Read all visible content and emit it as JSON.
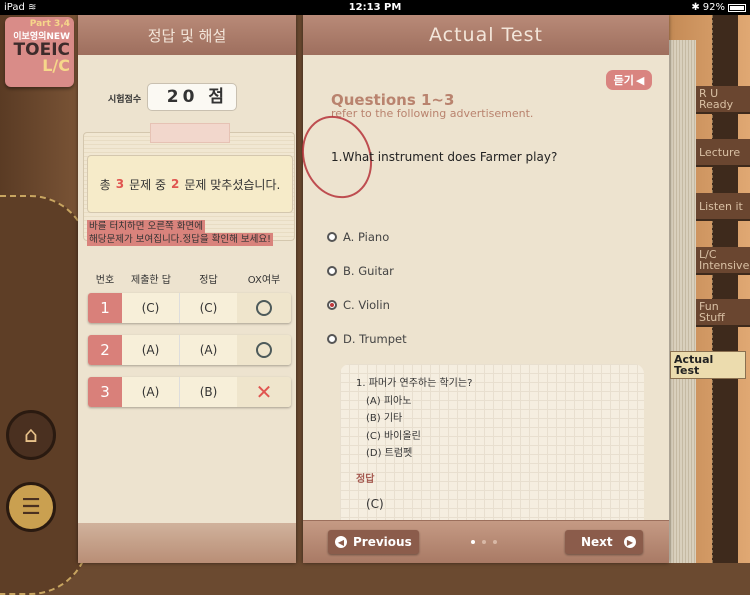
{
  "status": {
    "device": "iPad",
    "time": "12:13 PM",
    "battery": "92%",
    "battery_level": 0.92
  },
  "logo": {
    "part": "Part 3,4",
    "author": "이보영의NEW",
    "title": "TOEIC",
    "sub": "L/C"
  },
  "left": {
    "title": "정답 및 해설",
    "score_label": "시험점수",
    "score": "20 점",
    "summary": {
      "pre": "총",
      "total": "3",
      "mid": "문제 중",
      "correct": "2",
      "post": "문제 맞추셨습니다."
    },
    "hint": [
      "바를 터치하면 오른쪽 화면에",
      "해당문제가 보여집니다.정답을 확인해 보세요!"
    ],
    "columns": [
      "번호",
      "제출한 답",
      "정답",
      "OX여부"
    ],
    "rows": [
      {
        "no": "1",
        "submitted": "(C)",
        "answer": "(C)",
        "result": "O"
      },
      {
        "no": "2",
        "submitted": "(A)",
        "answer": "(A)",
        "result": "O"
      },
      {
        "no": "3",
        "submitted": "(A)",
        "answer": "(B)",
        "result": "X"
      }
    ]
  },
  "right": {
    "title": "Actual Test",
    "listen": "듣기",
    "q_title": "Questions 1~3",
    "q_sub": "refer to the following advertisement.",
    "question": "1.What instrument does Farmer play?",
    "options": [
      "A. Piano",
      "B. Guitar",
      "C. Violin",
      "D. Trumpet"
    ],
    "selected": "C",
    "explanation": {
      "q": "1. 파머가 연주하는 학기는?",
      "items": [
        "(A) 피아노",
        "(B) 기타",
        "(C) 바이올린",
        "(D) 트럼펫"
      ],
      "answer_label": "정답",
      "answer": "(C)"
    },
    "prev": "Previous",
    "next": "Next",
    "page": 1,
    "pages": 3
  },
  "tabs": [
    {
      "l1": "R U",
      "l2": "Ready"
    },
    {
      "l1": "Lecture",
      "l2": ""
    },
    {
      "l1": "Listen it",
      "l2": ""
    },
    {
      "l1": "L/C",
      "l2": "Intensive"
    },
    {
      "l1": "Fun",
      "l2": "Stuff"
    },
    {
      "l1": "Actual",
      "l2": "Test"
    }
  ],
  "active_tab": "Actual Test"
}
